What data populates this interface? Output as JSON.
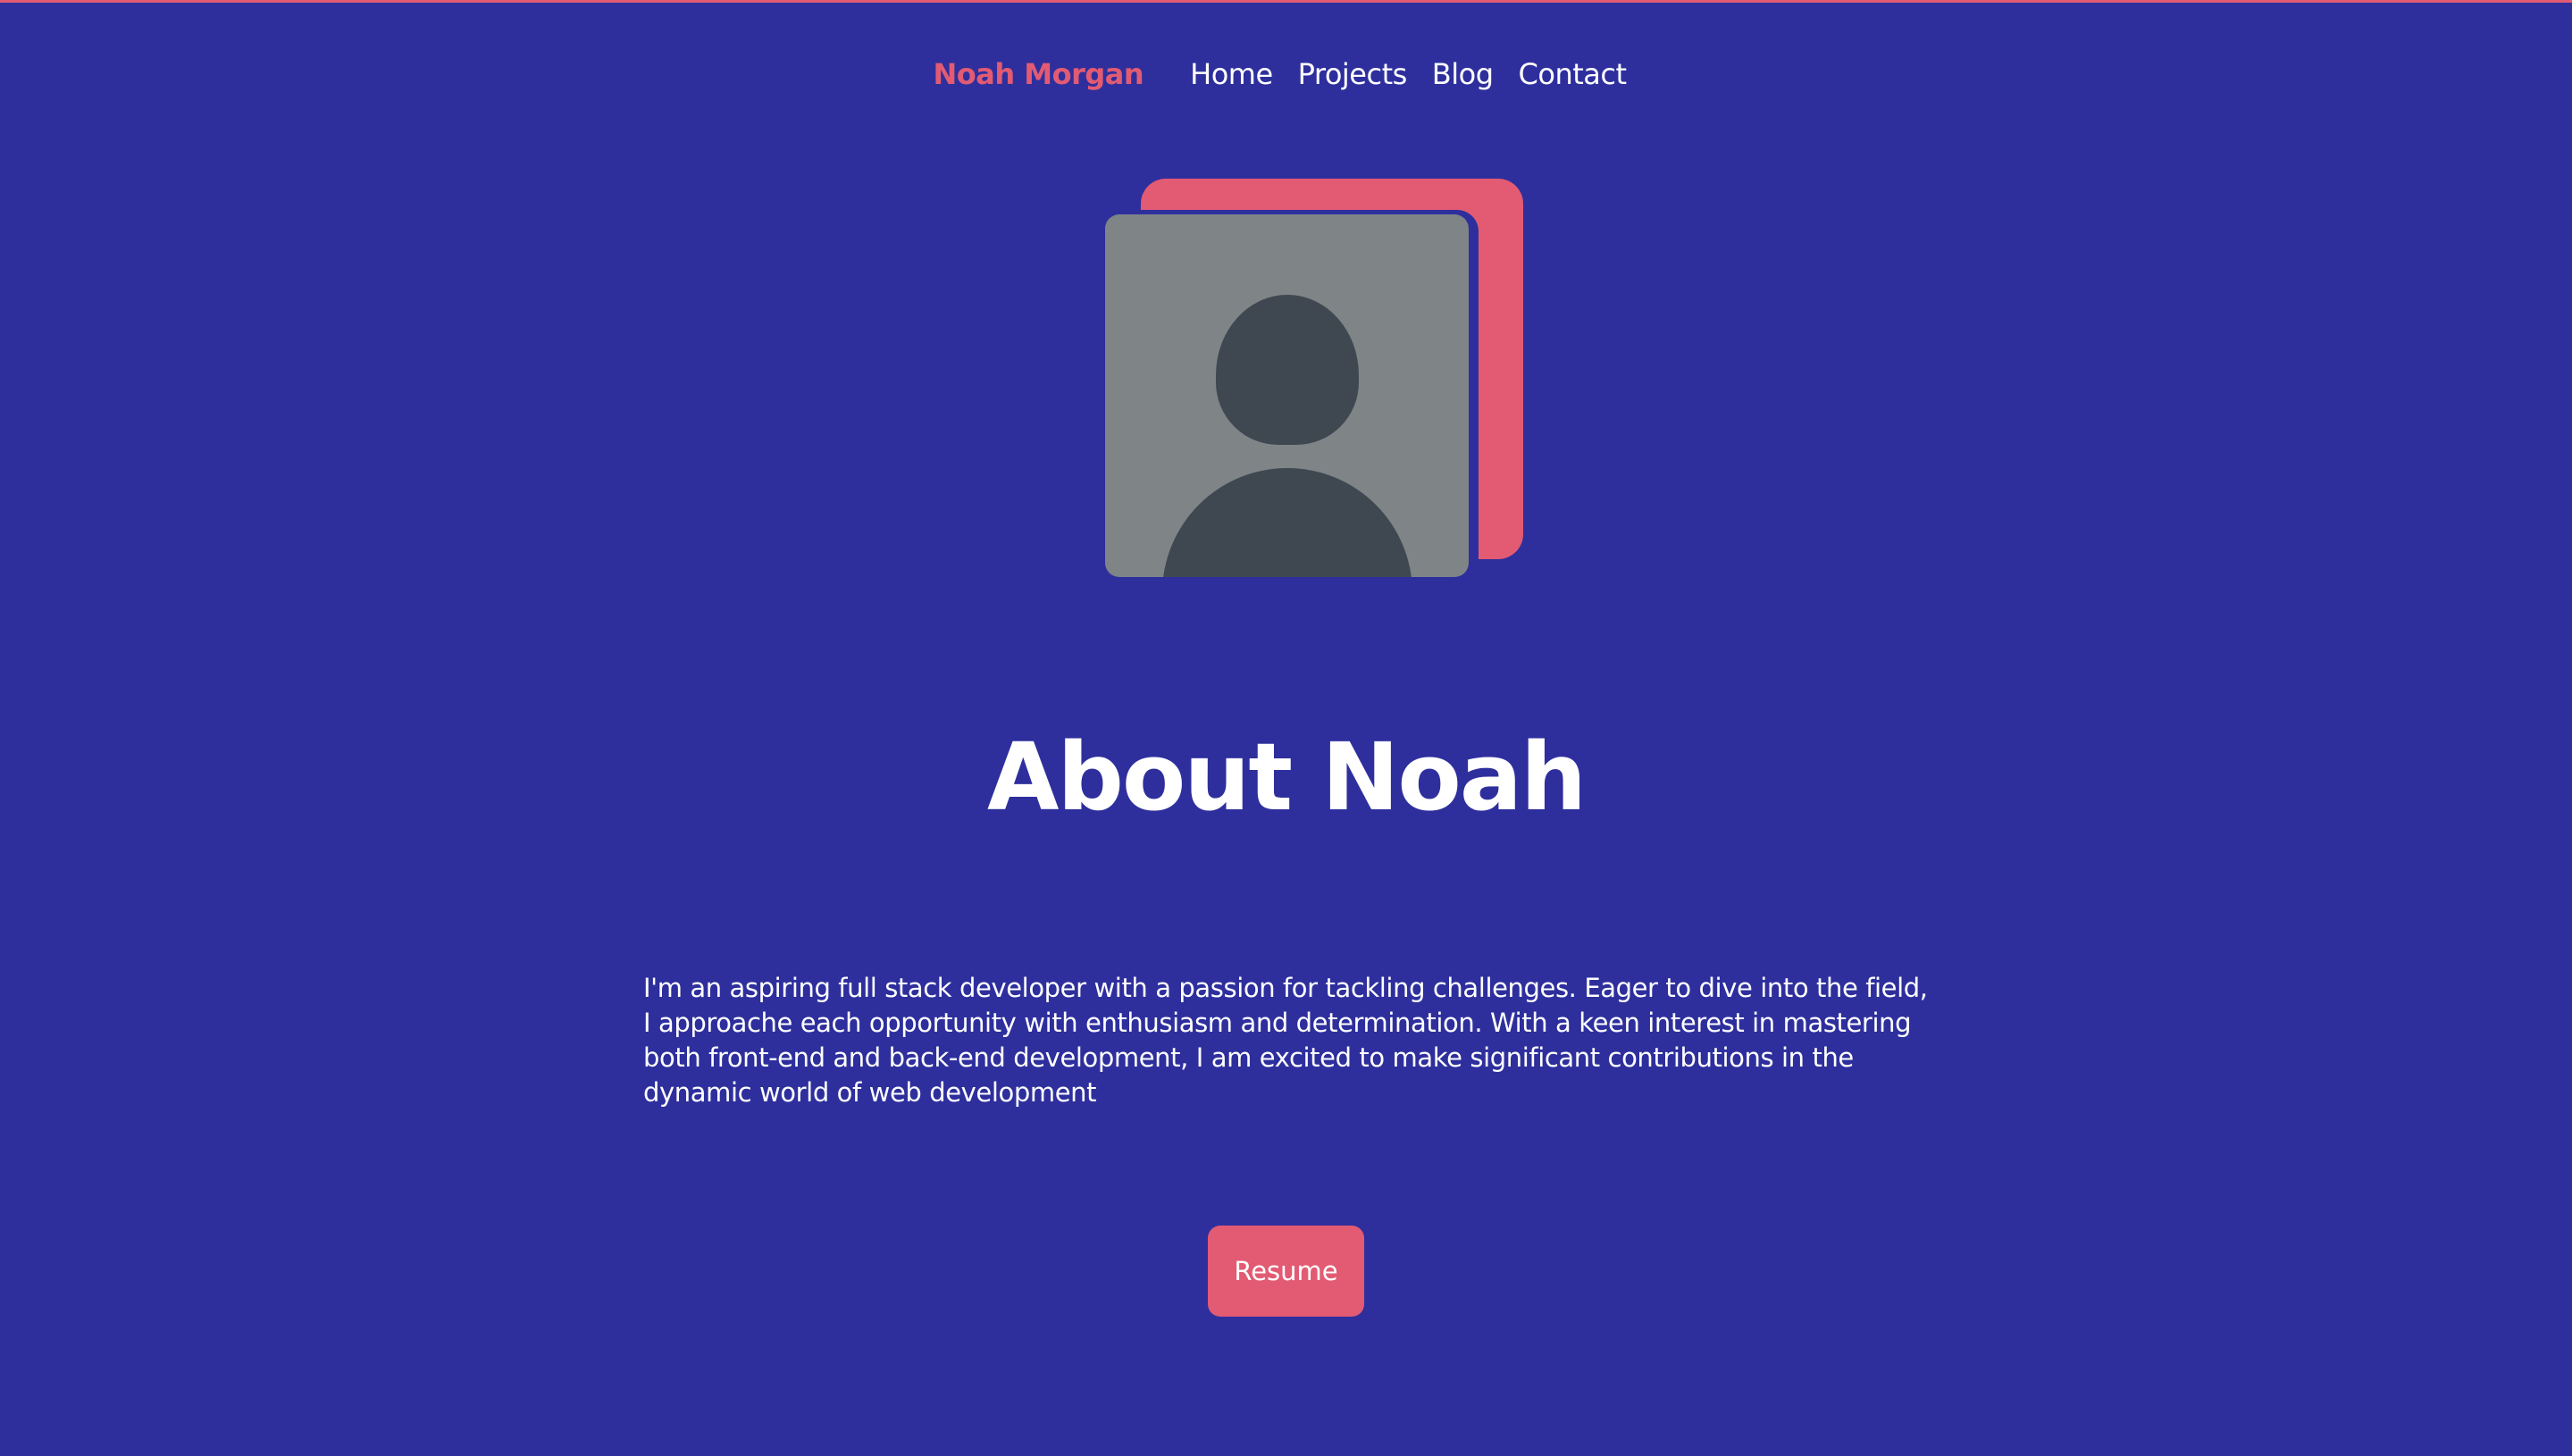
{
  "header": {
    "brand": "Noah Morgan",
    "nav": [
      {
        "label": "Home"
      },
      {
        "label": "Projects"
      },
      {
        "label": "Blog"
      },
      {
        "label": "Contact"
      }
    ]
  },
  "profile": {
    "avatar_icon": "user-placeholder-icon"
  },
  "main": {
    "title": "About Noah",
    "description": "I'm an aspiring full stack developer with a passion for tackling challenges. Eager to dive into the field, I approache each opportunity with enthusiasm and determination. With a keen interest in mastering both front-end and back-end development, I am excited to make significant contributions in the dynamic world of web development",
    "resume_label": "Resume"
  },
  "colors": {
    "background": "#2e2f9d",
    "accent": "#e25b73",
    "avatar_bg": "#7f8487",
    "avatar_fg": "#3f4850",
    "text": "#ffffff"
  }
}
